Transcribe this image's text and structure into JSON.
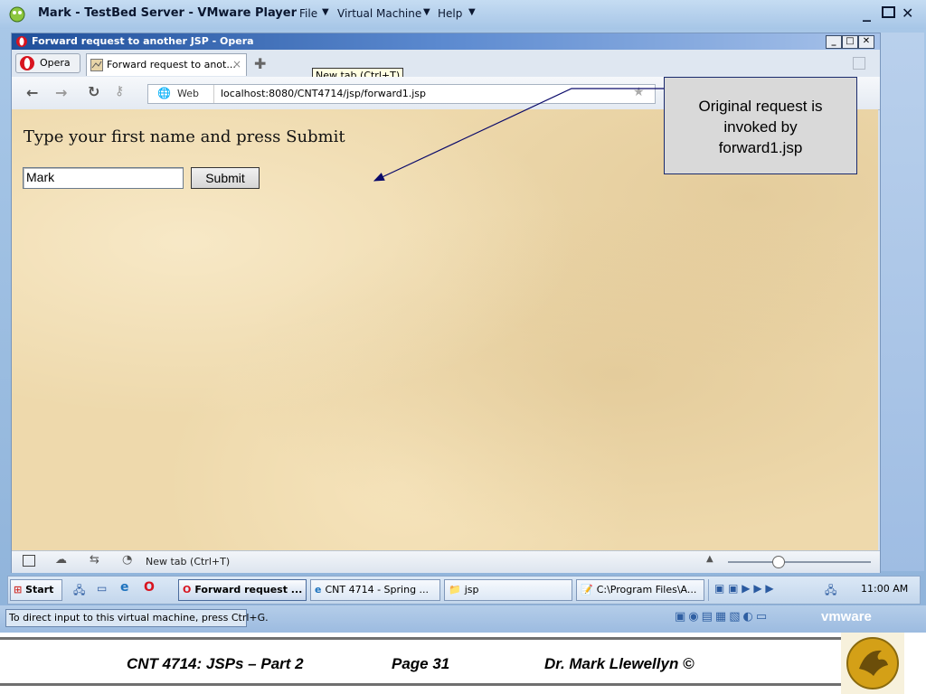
{
  "vmware": {
    "title": "Mark - TestBed Server - VMware Player",
    "menus": [
      "File",
      "Virtual Machine",
      "Help"
    ],
    "status_hint": "To direct input to this virtual machine, press Ctrl+G.",
    "brand": "vmware"
  },
  "opera": {
    "window_title": "Forward request to another JSP - Opera",
    "menu_button": "Opera",
    "tab_title": "Forward request to anot...",
    "tooltip": "New tab (Ctrl+T)",
    "address_badge": "Web",
    "url": "localhost:8080/CNT4714/jsp/forward1.jsp",
    "statusbar_text": "New tab (Ctrl+T)"
  },
  "page": {
    "prompt": "Type your first name and press Submit",
    "name_value": "Mark",
    "submit_label": "Submit"
  },
  "callout": {
    "line1": "Original request is",
    "line2": "invoked by",
    "line3": "forward1.jsp"
  },
  "taskbar": {
    "start": "Start",
    "tasks": [
      "Forward request ...",
      "CNT 4714 - Spring ...",
      "jsp",
      "C:\\Program Files\\A..."
    ],
    "clock": "11:00 AM"
  },
  "footer": {
    "course": "CNT 4714: JSPs – Part 2",
    "page": "Page 31",
    "author": "Dr. Mark Llewellyn ©"
  },
  "colors": {
    "accent": "#1f4f9a",
    "page_bg": "#eed9ac",
    "callout_bg": "#d9d9d9",
    "arrow": "#0a0a6a"
  }
}
